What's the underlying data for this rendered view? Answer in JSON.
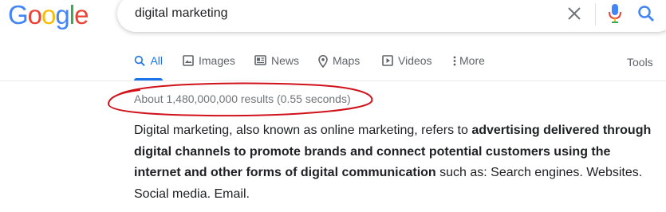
{
  "logo": {
    "letters": [
      "G",
      "o",
      "o",
      "g",
      "l",
      "e"
    ]
  },
  "search": {
    "query": "digital marketing"
  },
  "icons": {
    "clear": "close-icon",
    "voice": "mic-icon",
    "search": "search-icon"
  },
  "tabs": [
    {
      "label": "All",
      "icon": "search-icon",
      "active": true
    },
    {
      "label": "Images",
      "icon": "image-icon",
      "active": false
    },
    {
      "label": "News",
      "icon": "news-icon",
      "active": false
    },
    {
      "label": "Maps",
      "icon": "map-pin-icon",
      "active": false
    },
    {
      "label": "Videos",
      "icon": "video-icon",
      "active": false
    },
    {
      "label": "More",
      "icon": "more-vertical-icon",
      "active": false
    }
  ],
  "tools_label": "Tools",
  "result_stats": "About 1,480,000,000 results (0.55 seconds)",
  "snippet": {
    "p1": "Digital marketing, also known as online marketing, refers to ",
    "b1": "advertising delivered through digital channels to promote brands and connect potential customers using the internet and other forms of digital communication",
    "p2": " such as: Search engines. Websites. Social media. Email."
  },
  "colors": {
    "blue": "#4285f4",
    "red": "#ea4335",
    "yellow": "#fbbc05",
    "green": "#34a853",
    "accent": "#1a73e8",
    "annotation": "#d0121b"
  }
}
